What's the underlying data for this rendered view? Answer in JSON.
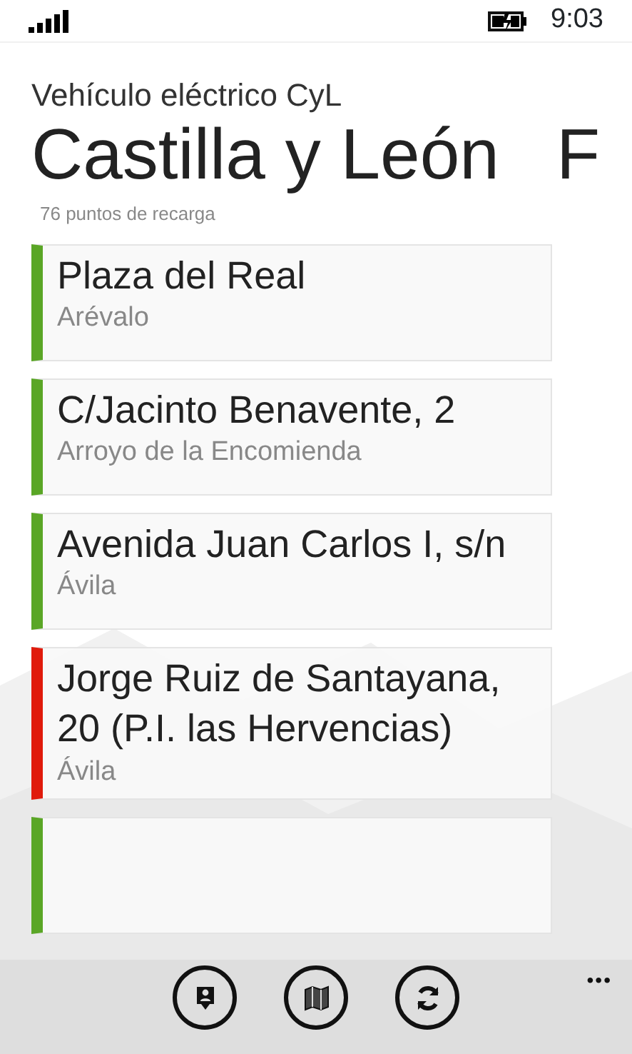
{
  "status_bar": {
    "time": "9:03"
  },
  "app_title": "Vehículo eléctrico CyL",
  "pivot": {
    "header": "Castilla y León",
    "next_header": "F",
    "subtitle": "76 puntos de recarga"
  },
  "stations": [
    {
      "address": "Plaza del Real",
      "town": "Arévalo",
      "color": "#5aa626"
    },
    {
      "address": "C/Jacinto Benavente, 2",
      "town": "Arroyo de la Encomienda",
      "color": "#5aa626"
    },
    {
      "address": "Avenida Juan Carlos I, s/n",
      "town": "Ávila",
      "color": "#5aa626"
    },
    {
      "address": "Jorge Ruiz de Santayana, 20 (P.I. las Hervencias)",
      "town": "Ávila",
      "color": "#e01b0c"
    },
    {
      "color": "#5aa626"
    }
  ],
  "app_bar": {
    "buttons": [
      {
        "kind": "pin"
      },
      {
        "kind": "map"
      },
      {
        "kind": "refresh"
      }
    ],
    "more": "•••"
  }
}
